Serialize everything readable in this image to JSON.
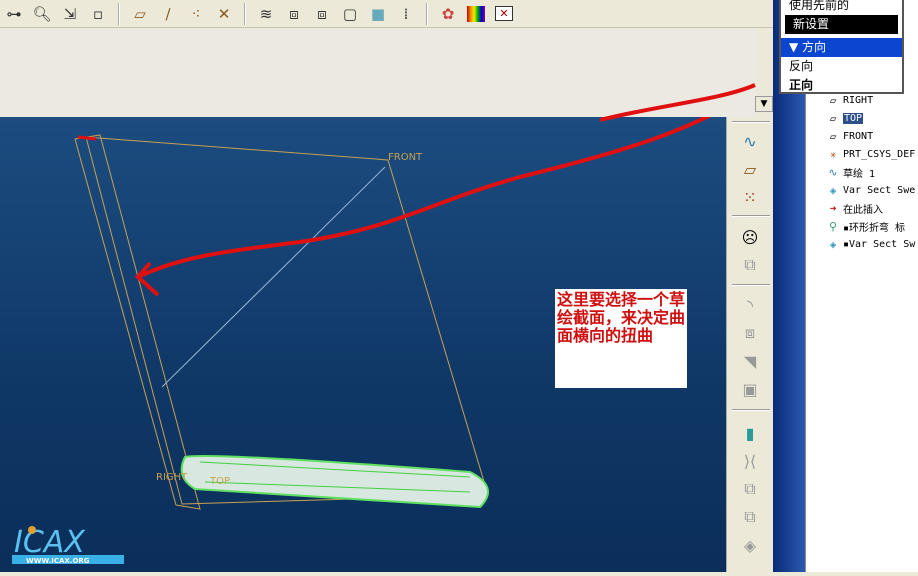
{
  "toolbar": {
    "icons": [
      "datum-csys-icon",
      "zoom-icon",
      "reorient-icon",
      "view-manager-icon",
      "plane-display-icon",
      "axis-display-icon",
      "point-display-icon",
      "csys-display-icon",
      "layers-icon",
      "wireframe-icon",
      "hidden-line-icon",
      "no-hidden-icon",
      "shading-icon",
      "model-tree-icon",
      "appearance-icon",
      "color-icon",
      "close-window-icon"
    ]
  },
  "menu": {
    "items": [
      "使用先前的",
      "新设置"
    ],
    "section": "方向",
    "options": [
      "反向",
      "正向"
    ],
    "selected": "正向"
  },
  "tree": {
    "items": [
      {
        "icon": "plane-icon",
        "label": "RIGHT"
      },
      {
        "icon": "plane-icon",
        "label": "TOP",
        "selected": true
      },
      {
        "icon": "plane-icon",
        "label": "FRONT"
      },
      {
        "icon": "csys-icon",
        "label": "PRT_CSYS_DEF"
      },
      {
        "icon": "sketch-icon",
        "label": "草绘 1"
      },
      {
        "icon": "sweep-icon",
        "label": "Var Sect Swe"
      },
      {
        "icon": "insert-here-icon",
        "label": "在此插入"
      },
      {
        "icon": "toroidal-bend-icon",
        "label": "▪环形折弯 标"
      },
      {
        "icon": "sweep-icon",
        "label": "▪Var Sect Sw"
      }
    ]
  },
  "viewport": {
    "labels": {
      "front": "FRONT",
      "right": "RIGHT",
      "top": "TOP"
    }
  },
  "note": "这里要选择一个草绘截面，来决定曲面横向的扭曲",
  "logo": {
    "name": "ICAX",
    "url": "WWW.ICAX.ORG"
  },
  "colors": {
    "annotation": "#d01010",
    "viewport": "#0f3766",
    "selection": "#0a46d0"
  }
}
